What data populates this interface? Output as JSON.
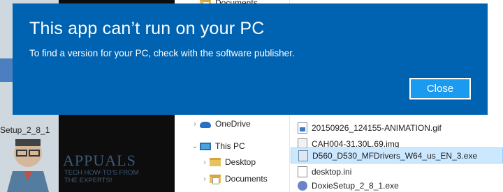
{
  "dialog": {
    "title": "This app can’t run on your PC",
    "message": "To find a version for your PC, check with the software publisher.",
    "close_label": "Close"
  },
  "desktop": {
    "icon_label": "Setup_2_8_1"
  },
  "explorer": {
    "nav_items": [
      {
        "label": "Documents",
        "icon": "documents-folder-icon"
      },
      {
        "label": "OneDrive",
        "icon": "onedrive-cloud-icon"
      },
      {
        "label": "This PC",
        "icon": "this-pc-icon"
      },
      {
        "label": "Desktop",
        "icon": "desktop-folder-icon"
      },
      {
        "label": "Documents",
        "icon": "documents-folder-icon"
      }
    ],
    "files": [
      {
        "name": "20150926_124155-ANIMATION.gif",
        "icon": "gif-file-icon",
        "selected": false
      },
      {
        "name": "CAH004-31.30L.69.img",
        "icon": "img-file-icon",
        "selected": false
      },
      {
        "name": "D560_D530_MFDrivers_W64_us_EN_3.exe",
        "icon": "exe-file-icon",
        "selected": true
      },
      {
        "name": "desktop.ini",
        "icon": "ini-file-icon",
        "selected": false
      },
      {
        "name": "DoxieSetup_2_8_1.exe",
        "icon": "setup-file-icon",
        "selected": false
      }
    ]
  },
  "watermark": {
    "brand": "APPUALS",
    "tagline_1": "TECH HOW-TO'S FROM",
    "tagline_2": "THE EXPERTS!"
  },
  "colors": {
    "dialog_bg": "#0063b1",
    "button_bg": "#1a9bf0",
    "selection_bg": "#cce8ff"
  }
}
